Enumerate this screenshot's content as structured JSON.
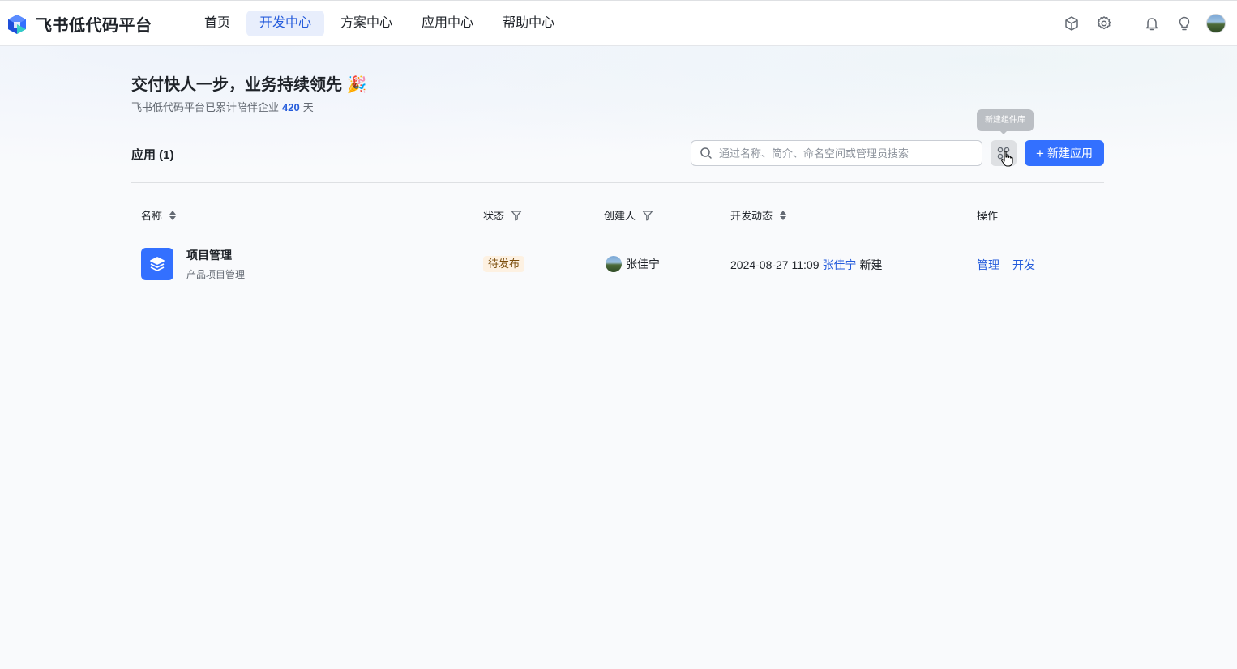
{
  "header": {
    "brand": "飞书低代码平台",
    "nav": [
      {
        "label": "首页",
        "active": false
      },
      {
        "label": "开发中心",
        "active": true
      },
      {
        "label": "方案中心",
        "active": false
      },
      {
        "label": "应用中心",
        "active": false
      },
      {
        "label": "帮助中心",
        "active": false
      }
    ],
    "icons": [
      "cube-icon",
      "gear-icon",
      "bell-icon",
      "lightbulb-icon"
    ]
  },
  "hero": {
    "headline": "交付快人一步，业务持续领先",
    "emoji": "🎉",
    "subline_prefix": "飞书低代码平台已累计陪伴企业",
    "days": "420",
    "subline_suffix": "天"
  },
  "apps_section": {
    "title": "应用 (1)",
    "search_placeholder": "通过名称、简介、命名空间或管理员搜索",
    "library_tooltip": "新建组件库",
    "new_app_label": "新建应用"
  },
  "table": {
    "headers": {
      "name": "名称",
      "status": "状态",
      "creator": "创建人",
      "activity": "开发动态",
      "actions": "操作"
    },
    "rows": [
      {
        "name": "项目管理",
        "description": "产品项目管理",
        "status": "待发布",
        "creator": "张佳宁",
        "activity_time": "2024-08-27 11:09",
        "activity_user": "张佳宁",
        "activity_action": "新建",
        "action_manage": "管理",
        "action_develop": "开发"
      }
    ]
  },
  "colors": {
    "accent": "#3370ff",
    "link": "#245bdb",
    "status_bg": "#fdf1e2",
    "status_text": "#7a4c0a"
  }
}
